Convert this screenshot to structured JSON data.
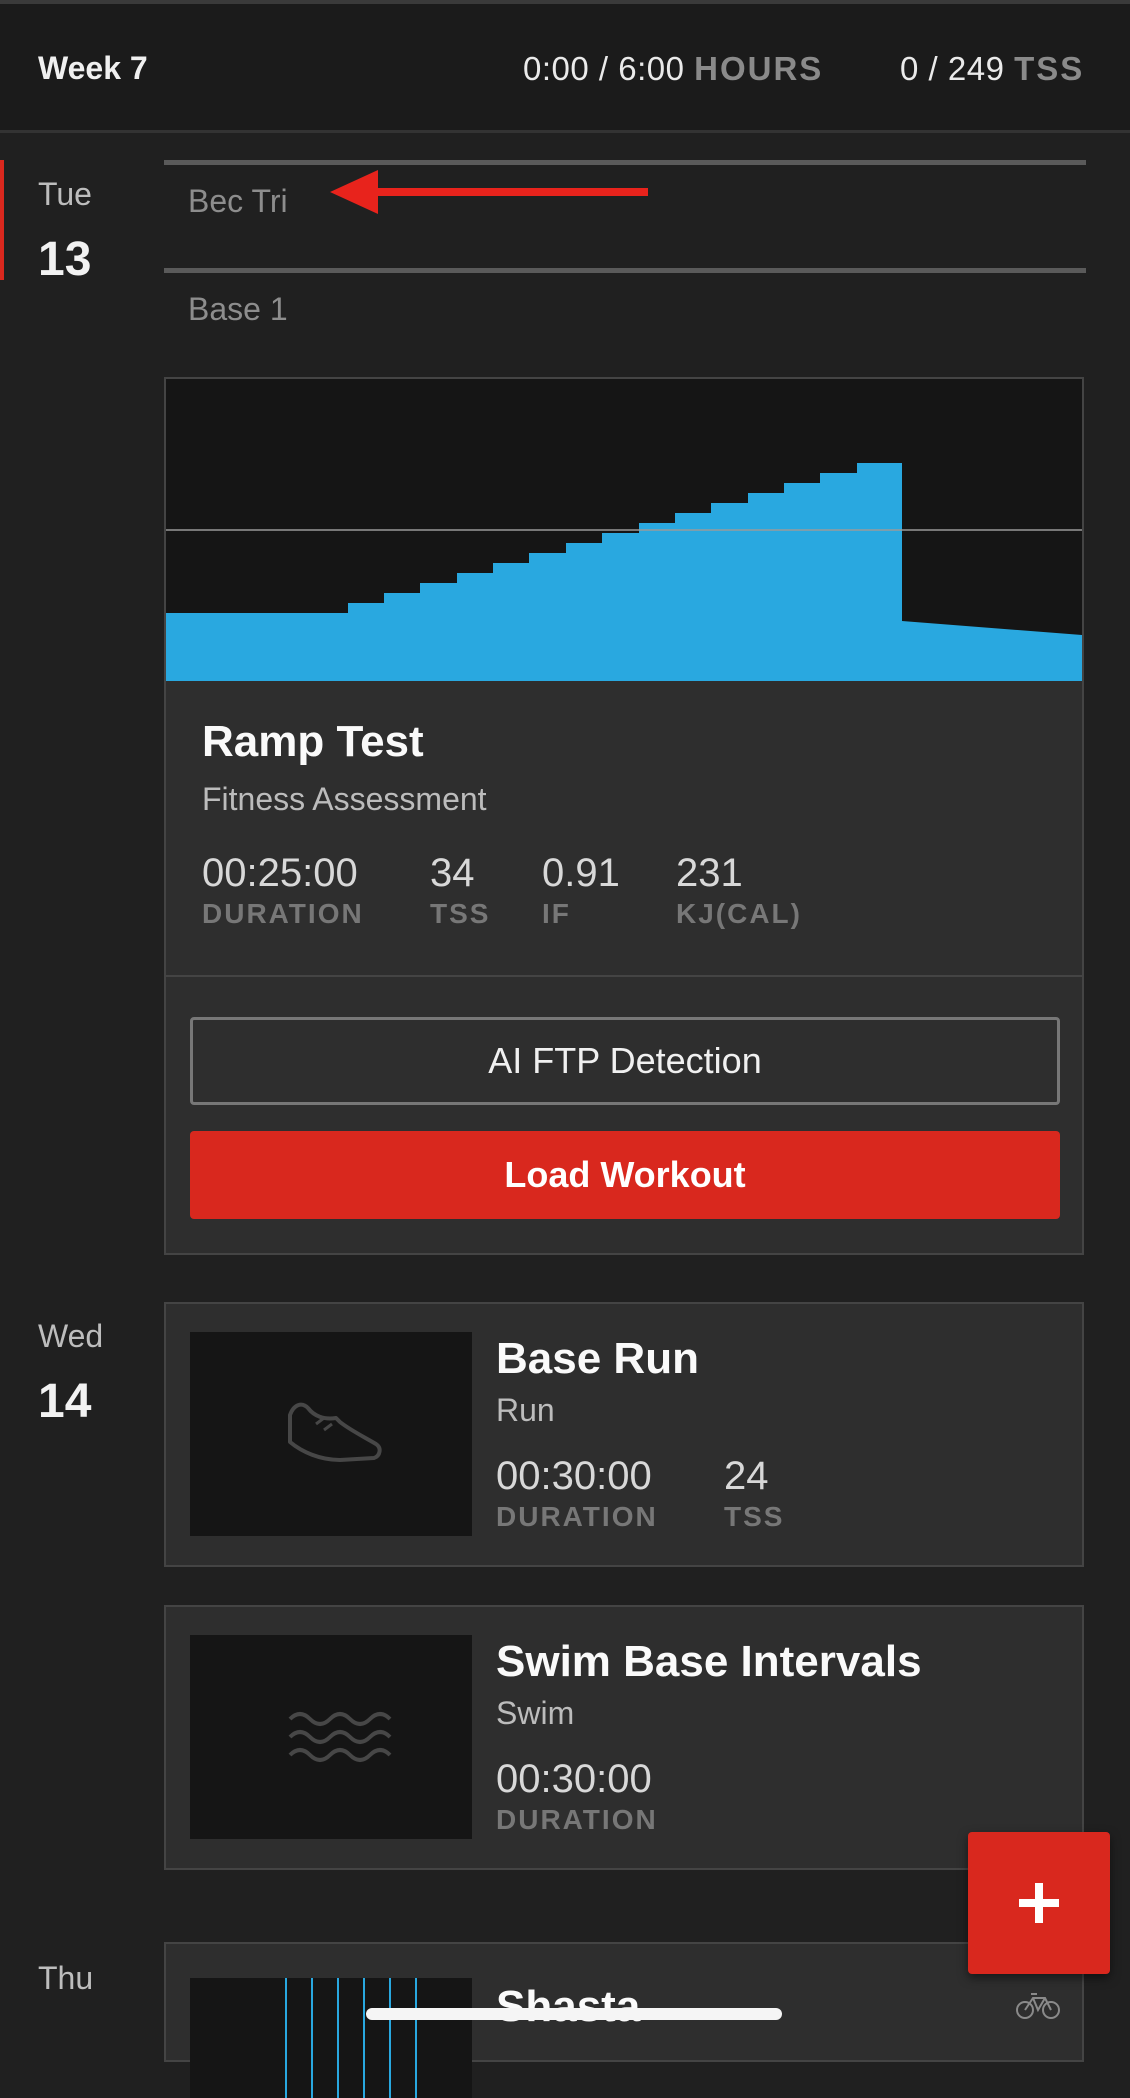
{
  "week": {
    "label": "Week 7",
    "hours_value": "0:00 / 6:00",
    "hours_unit": "HOURS",
    "tss_value": "0 / 249",
    "tss_unit": "TSS"
  },
  "days": [
    {
      "name": "Tue",
      "number": "13",
      "plans": [
        "Bec Tri",
        "Base 1"
      ],
      "workout": {
        "title": "Ramp Test",
        "subtitle": "Fitness Assessment",
        "stats": [
          {
            "value": "00:25:00",
            "label": "DURATION"
          },
          {
            "value": "34",
            "label": "TSS"
          },
          {
            "value": "0.91",
            "label": "IF"
          },
          {
            "value": "231",
            "label": "KJ(CAL)"
          }
        ],
        "ftp_button": "AI FTP Detection",
        "load_button": "Load Workout"
      }
    },
    {
      "name": "Wed",
      "number": "14",
      "cards": [
        {
          "title": "Base Run",
          "subtitle": "Run",
          "icon": "shoe-icon",
          "stats": [
            {
              "value": "00:30:00",
              "label": "DURATION"
            },
            {
              "value": "24",
              "label": "TSS"
            }
          ]
        },
        {
          "title": "Swim Base Intervals",
          "subtitle": "Swim",
          "icon": "waves-icon",
          "stats": [
            {
              "value": "00:30:00",
              "label": "DURATION"
            }
          ]
        }
      ]
    },
    {
      "name": "Thu",
      "cards": [
        {
          "title": "Shasta",
          "icon": "bike-icon"
        }
      ]
    }
  ],
  "colors": {
    "accent_red": "#d9281e",
    "chart_blue": "#29a8e0",
    "background": "#202020",
    "card": "#2e2e2e"
  },
  "fab_icon": "plus-icon"
}
